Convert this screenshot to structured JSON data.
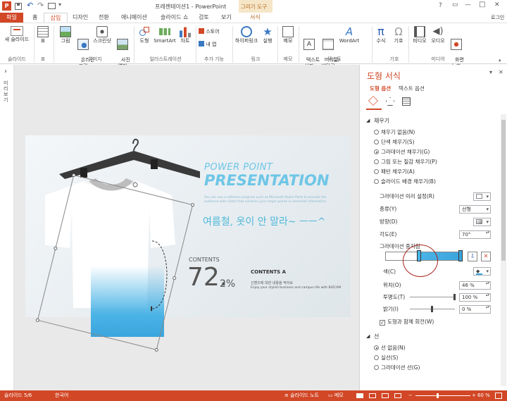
{
  "window": {
    "title": "프레젠테이션1 - PowerPoint",
    "context_tab_group": "그리기 도구",
    "login": "로그인",
    "colors": {
      "accent": "#d24726",
      "context": "#f6e6c8",
      "context_text": "#b5651d"
    }
  },
  "quick_access": {
    "icons": [
      "powerpoint-logo",
      "save-icon",
      "undo-icon",
      "redo-icon",
      "present-icon",
      "customize-icon"
    ]
  },
  "window_controls": {
    "help": "?",
    "restore": "▭",
    "minimize": "—",
    "maximize": "□",
    "close": "✕"
  },
  "tabs": [
    {
      "label": "파일"
    },
    {
      "label": "홈"
    },
    {
      "label": "삽입"
    },
    {
      "label": "디자인"
    },
    {
      "label": "전환"
    },
    {
      "label": "애니메이션"
    },
    {
      "label": "슬라이드 쇼"
    },
    {
      "label": "검토"
    },
    {
      "label": "보기"
    },
    {
      "label": "서식"
    }
  ],
  "ribbon": {
    "buttons": [
      {
        "label": "새 슬라이드"
      },
      {
        "label": "표"
      },
      {
        "label": "그림"
      },
      {
        "label": "온라인\n그림"
      },
      {
        "label": "스크린샷"
      },
      {
        "label": "사진\n앨범"
      },
      {
        "label": "도형"
      },
      {
        "label": "SmartArt"
      },
      {
        "label": "차트"
      },
      {
        "label": "스토어"
      },
      {
        "label": "내 앱"
      },
      {
        "label": "하이퍼링크"
      },
      {
        "label": "실행"
      },
      {
        "label": "메모"
      },
      {
        "label": "텍스트\n상자"
      },
      {
        "label": "머리글/\n바닥글"
      },
      {
        "label": "WordArt"
      },
      {
        "label": "수식"
      },
      {
        "label": "기호"
      },
      {
        "label": "비디오"
      },
      {
        "label": "오디오"
      },
      {
        "label": "화면\n녹화"
      }
    ],
    "groups": [
      "슬라이드",
      "표",
      "이미지",
      "일러스트레이션",
      "추가 기능",
      "링크",
      "메모",
      "텍스트",
      "기호",
      "미디어"
    ]
  },
  "left_panel": {
    "toggle": "›",
    "label": "미리 보기"
  },
  "slide": {
    "title1": "POWER POINT",
    "title2": "PRESENTATION",
    "subtitle": "You can use a software program such as Microsoft Power Point to provide the audience with slides that contains your major points or essential information",
    "handwriting": "여름철, 옷이 안 말라~ ㅡㅡ^",
    "contents_label": "CONTENTS",
    "big_number": "72.",
    "percent": "2%",
    "contents_a": "CONTENTS A",
    "desc_kr": "신밴즈에 대한 내용을 적어요",
    "desc_en": "Enjoy your stylish business and campus life with BIZCAM",
    "colors": {
      "title": "#6ec6e6",
      "handwriting": "#4fb8d8",
      "number": "#555555",
      "shirt_fill": "#4ab3e6"
    }
  },
  "pane": {
    "title": "도형 서식",
    "close": "✕",
    "dropdown": "▾",
    "tabs": [
      "도형 옵션",
      "텍스트 옵션"
    ],
    "icon_tabs": [
      "fill-line-icon",
      "effects-icon",
      "size-properties-icon"
    ],
    "fill_section": "채우기",
    "fill_options": [
      {
        "label": "채우기 없음(N)",
        "checked": false
      },
      {
        "label": "단색 채우기(S)",
        "checked": false
      },
      {
        "label": "그라데이션 채우기(G)",
        "checked": true
      },
      {
        "label": "그림 또는 질감 채우기(P)",
        "checked": false
      },
      {
        "label": "패턴 채우기(A)",
        "checked": false
      },
      {
        "label": "슬라이드 배경 채우기(B)",
        "checked": false
      }
    ],
    "preset_label": "그라데이션 미리 설정(R)",
    "type_label": "종류(Y)",
    "type_value": "선형",
    "direction_label": "방향(D)",
    "angle_label": "각도(E)",
    "angle_value": "70°",
    "stops_label": "그라데이션 중지점",
    "color_label": "색(C)",
    "position_label": "위치(O)",
    "position_value": "46 %",
    "transparency_label": "투명도(T)",
    "transparency_value": "100 %",
    "transparency_fraction": 1.0,
    "brightness_label": "밝기(I)",
    "brightness_value": "0 %",
    "brightness_fraction": 0.5,
    "rotate_label": "도형과 함께 회전(W)",
    "rotate_checked": true,
    "line_section": "선",
    "line_options": [
      {
        "label": "선 없음(N)",
        "checked": true
      },
      {
        "label": "실선(S)",
        "checked": false
      },
      {
        "label": "그라데이션 선(G)",
        "checked": false
      }
    ]
  },
  "status": {
    "slide": "슬라이드 5/6",
    "language": "한국어",
    "notes": "슬라이드 노트",
    "comments": "메모",
    "zoom": "60 %",
    "zoom_out": "−",
    "zoom_in": "+"
  }
}
